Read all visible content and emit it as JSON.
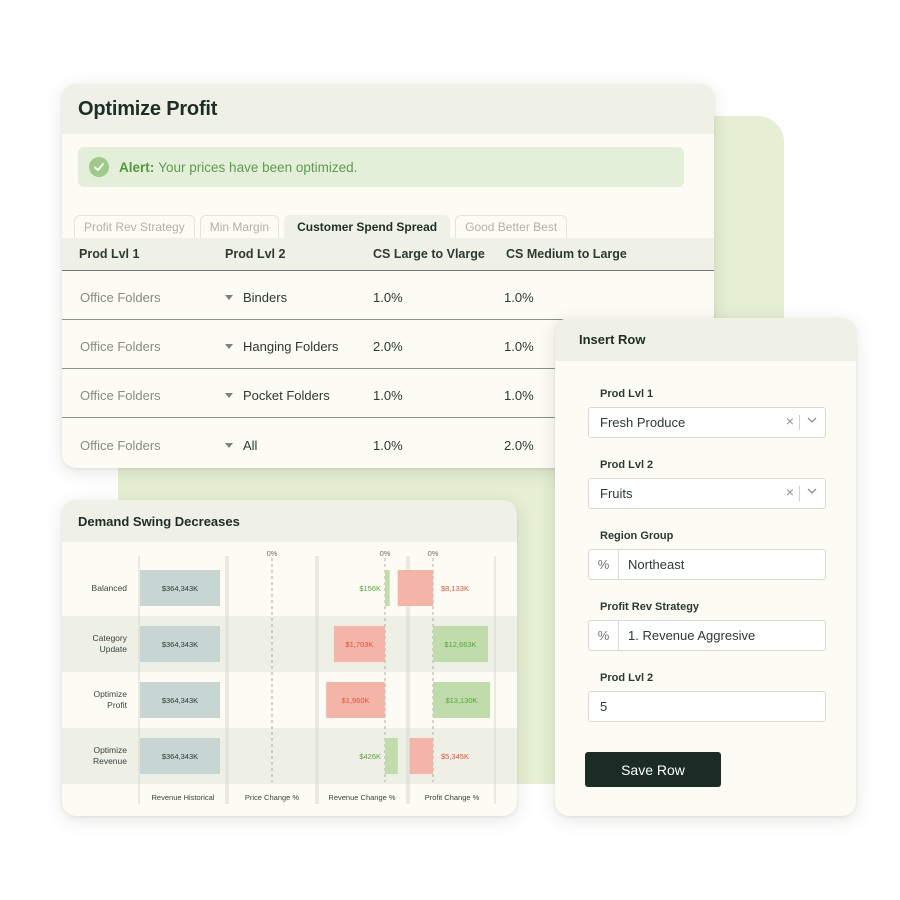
{
  "optimize": {
    "title": "Optimize Profit",
    "alert": {
      "strong": "Alert:",
      "text": "Your prices have been optimized."
    },
    "tabs": [
      "Profit Rev Strategy",
      "Min Margin",
      "Customer Spend Spread",
      "Good Better Best"
    ],
    "active_tab": "Customer Spend Spread",
    "columns": [
      "Prod Lvl 1",
      "Prod Lvl 2",
      "CS Large to Vlarge",
      "CS Medium to Large"
    ],
    "rows": [
      [
        "Office Folders",
        "Binders",
        "1.0%",
        "1.0%"
      ],
      [
        "Office Folders",
        "Hanging Folders",
        "2.0%",
        "1.0%"
      ],
      [
        "Office Folders",
        "Pocket Folders",
        "1.0%",
        "1.0%"
      ],
      [
        "Office Folders",
        "All",
        "1.0%",
        "2.0%"
      ]
    ]
  },
  "demand": {
    "title": "Demand Swing Decreases",
    "colors": {
      "neutral": "#c8d6d3",
      "negative": "#f5b4a8",
      "positive": "#bfdcaa",
      "neg_text": "#e2533a",
      "pos_text": "#58a53b"
    }
  },
  "chart_data": {
    "type": "bar",
    "categories": [
      "Balanced",
      "Category Update",
      "Optimize Profit",
      "Optimize Revenue"
    ],
    "columns": [
      "Revenue Historical",
      "Price Change %",
      "Revenue Change %",
      "Profit Change %"
    ],
    "zero_label": "0%",
    "revenue_historical": {
      "values": [
        364343,
        364343,
        364343,
        364343
      ],
      "labels": [
        "$364,343K",
        "$364,343K",
        "$364,343K",
        "$364,343K"
      ]
    },
    "price_change": {
      "values": [
        0,
        0,
        0,
        0
      ]
    },
    "revenue_change": {
      "values": [
        156,
        -1703,
        -1960,
        426
      ],
      "labels": [
        "$156K",
        "$1,703K",
        "$1,960K",
        "$426K"
      ]
    },
    "profit_change": {
      "values": [
        -8133,
        12663,
        13130,
        -5345
      ],
      "labels": [
        "$8,133K",
        "$12,663K",
        "$13,130K",
        "$5,345K"
      ]
    }
  },
  "insert": {
    "title": "Insert Row",
    "fields": [
      {
        "label": "Prod Lvl 1",
        "value": "Fresh Produce"
      },
      {
        "label": "Prod Lvl 2",
        "value": "Fruits"
      },
      {
        "label": "Region Group",
        "prefix": "%",
        "value": "Northeast"
      },
      {
        "label": "Profit Rev Strategy",
        "prefix": "%",
        "value": "1. Revenue Aggresive"
      },
      {
        "label": "Prod Lvl 2",
        "value": "5"
      }
    ],
    "save": "Save Row"
  }
}
